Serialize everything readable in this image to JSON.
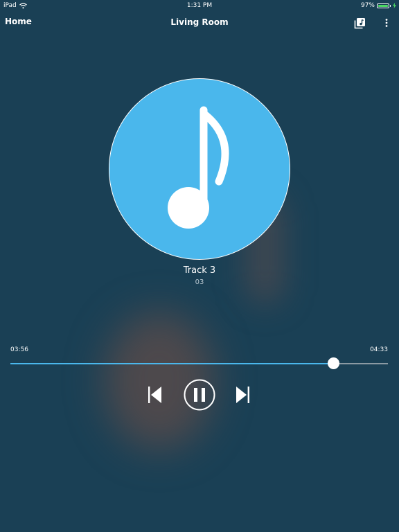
{
  "status_bar": {
    "device": "iPad",
    "time": "1:31 PM",
    "battery_percent": "97%",
    "battery_level": 0.97,
    "battery_color": "#4cd964"
  },
  "nav": {
    "home_label": "Home",
    "title": "Living Room",
    "queue_icon": "music-queue-icon",
    "more_icon": "more-vertical-icon"
  },
  "now_playing": {
    "artwork_icon": "music-note-icon",
    "artwork_color": "#4ab7ec",
    "track_title": "Track 3",
    "track_subtitle": "03"
  },
  "progress": {
    "elapsed": "03:56",
    "total": "04:33",
    "fraction": 0.855,
    "accent_color": "#4ab7ec"
  },
  "controls": {
    "prev_icon": "skip-previous-icon",
    "pause_icon": "pause-icon",
    "next_icon": "skip-next-icon"
  },
  "colors": {
    "background": "#1a4055"
  }
}
